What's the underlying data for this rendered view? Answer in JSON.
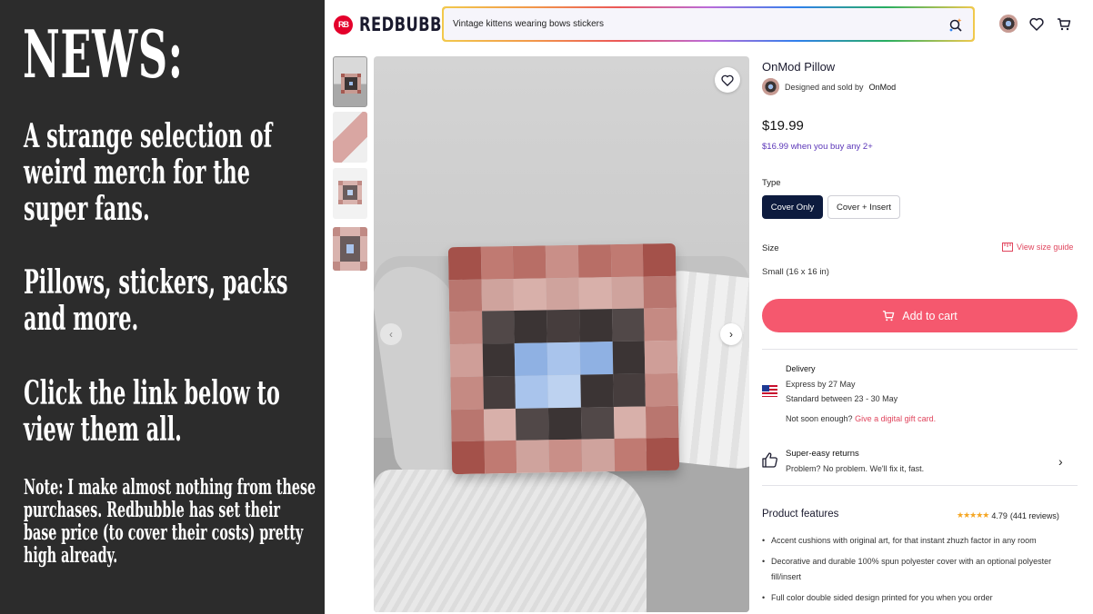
{
  "news": {
    "title": "NEWS:",
    "para1": "A strange selection of weird merch for the super fans.",
    "para2": "Pillows, stickers, packs and more.",
    "para3": "Click the link below to view them all.",
    "note": "Note: I make almost nothing from these purchases. Redbubble has set their base price (to cover their costs) pretty high already."
  },
  "header": {
    "logo_badge": "RB",
    "logo_text": "REDBUBBLE",
    "search_value": "Vintage kittens wearing bows stickers",
    "icons": [
      "sparkle-search-icon",
      "avatar",
      "heart-icon",
      "cart-icon"
    ]
  },
  "gallery": {
    "thumbnail_count": 4,
    "prev_label": "‹",
    "next_label": "›"
  },
  "product": {
    "title": "OnMod Pillow",
    "artist_prefix": "Designed and sold by",
    "artist_name": "OnMod",
    "price": "$19.99",
    "bulk_price": "$16.99 when you buy any 2+",
    "type_label": "Type",
    "type_options": [
      "Cover Only",
      "Cover + Insert"
    ],
    "type_selected": "Cover Only",
    "size_label": "Size",
    "size_guide": "View size guide",
    "size_value": "Small (16 x 16 in)",
    "add_to_cart": "Add to cart"
  },
  "delivery": {
    "title": "Delivery",
    "express": "Express by 27 May",
    "standard": "Standard between 23 - 30 May",
    "not_soon": "Not soon enough?",
    "gift_link": "Give a digital gift card."
  },
  "returns": {
    "title": "Super-easy returns",
    "subtitle": "Problem? No problem. We'll fix it, fast."
  },
  "features": {
    "title": "Product features",
    "rating": "4.79",
    "reviews": "(441 reviews)",
    "stars": "★★★★★",
    "items": [
      "Accent cushions with original art, for that instant zhuzh factor in any room",
      "Decorative and durable 100% spun polyester cover with an optional polyester fill/insert",
      "Full color double sided design printed for you when you order"
    ]
  },
  "colors": {
    "accent": "#f5586e",
    "selected_option": "#0d1b3e",
    "bulk_text": "#5a35b8",
    "news_bg": "#2c2c2c"
  }
}
